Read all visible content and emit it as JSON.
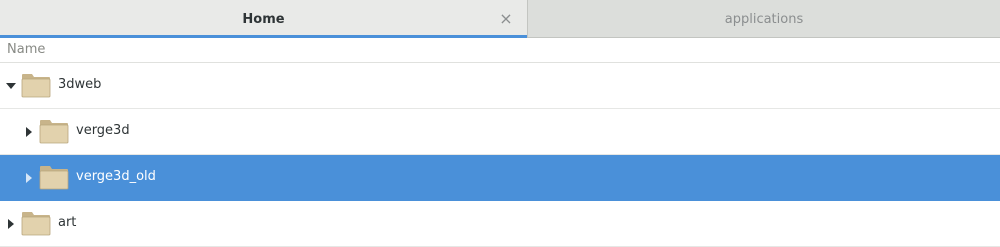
{
  "tabs": [
    {
      "label": "Home",
      "active": true,
      "close": "×"
    },
    {
      "label": "applications",
      "active": false
    }
  ],
  "column": {
    "name": "Name"
  },
  "rows": [
    {
      "label": "3dweb",
      "depth": 0,
      "expanded": true,
      "selected": false,
      "icon": "folder-icon"
    },
    {
      "label": "verge3d",
      "depth": 1,
      "expanded": false,
      "selected": false,
      "icon": "folder-icon"
    },
    {
      "label": "verge3d_old",
      "depth": 1,
      "expanded": false,
      "selected": true,
      "icon": "folder-icon"
    },
    {
      "label": "art",
      "depth": 0,
      "expanded": false,
      "selected": false,
      "icon": "folder-icon"
    }
  ],
  "colors": {
    "accent": "#4a90d9",
    "folder": "#e2d2ad",
    "folder_tab": "#c8b48a"
  }
}
